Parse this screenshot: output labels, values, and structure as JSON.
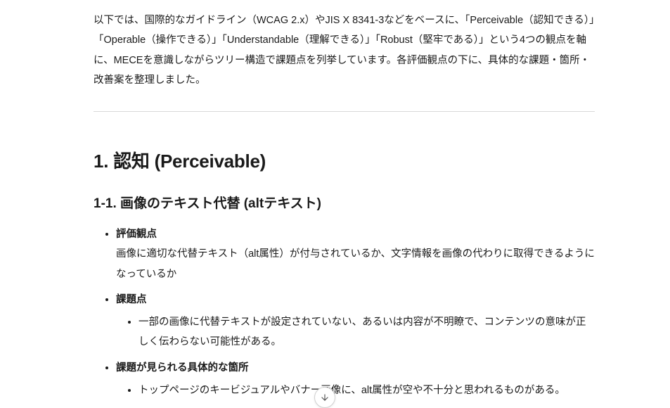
{
  "intro": "以下では、国際的なガイドライン（WCAG 2.x）やJIS X 8341-3などをベースに、「Perceivable（認知できる）」「Operable（操作できる）」「Understandable（理解できる）」「Robust（堅牢である）」という4つの観点を軸に、MECEを意識しながらツリー構造で課題点を列挙しています。各評価観点の下に、具体的な課題・箇所・改善案を整理しました。",
  "section1": {
    "heading": "1. 認知 (Perceivable)",
    "sub1": {
      "heading": "1-1. 画像のテキスト代替 (altテキスト)",
      "items": {
        "label_eval": "評価観点",
        "eval_text": "画像に適切な代替テキスト（alt属性）が付与されているか、文字情報を画像の代わりに取得できるようになっているか",
        "label_issue": "課題点",
        "issue_text": "一部の画像に代替テキストが設定されていない、あるいは内容が不明瞭で、コンテンツの意味が正しく伝わらない可能性がある。",
        "label_location": "課題が見られる具体的な箇所",
        "location_text": "トップページのキービジュアルやバナー画像に、alt属性が空や不十分と思われるものがある。"
      }
    }
  }
}
